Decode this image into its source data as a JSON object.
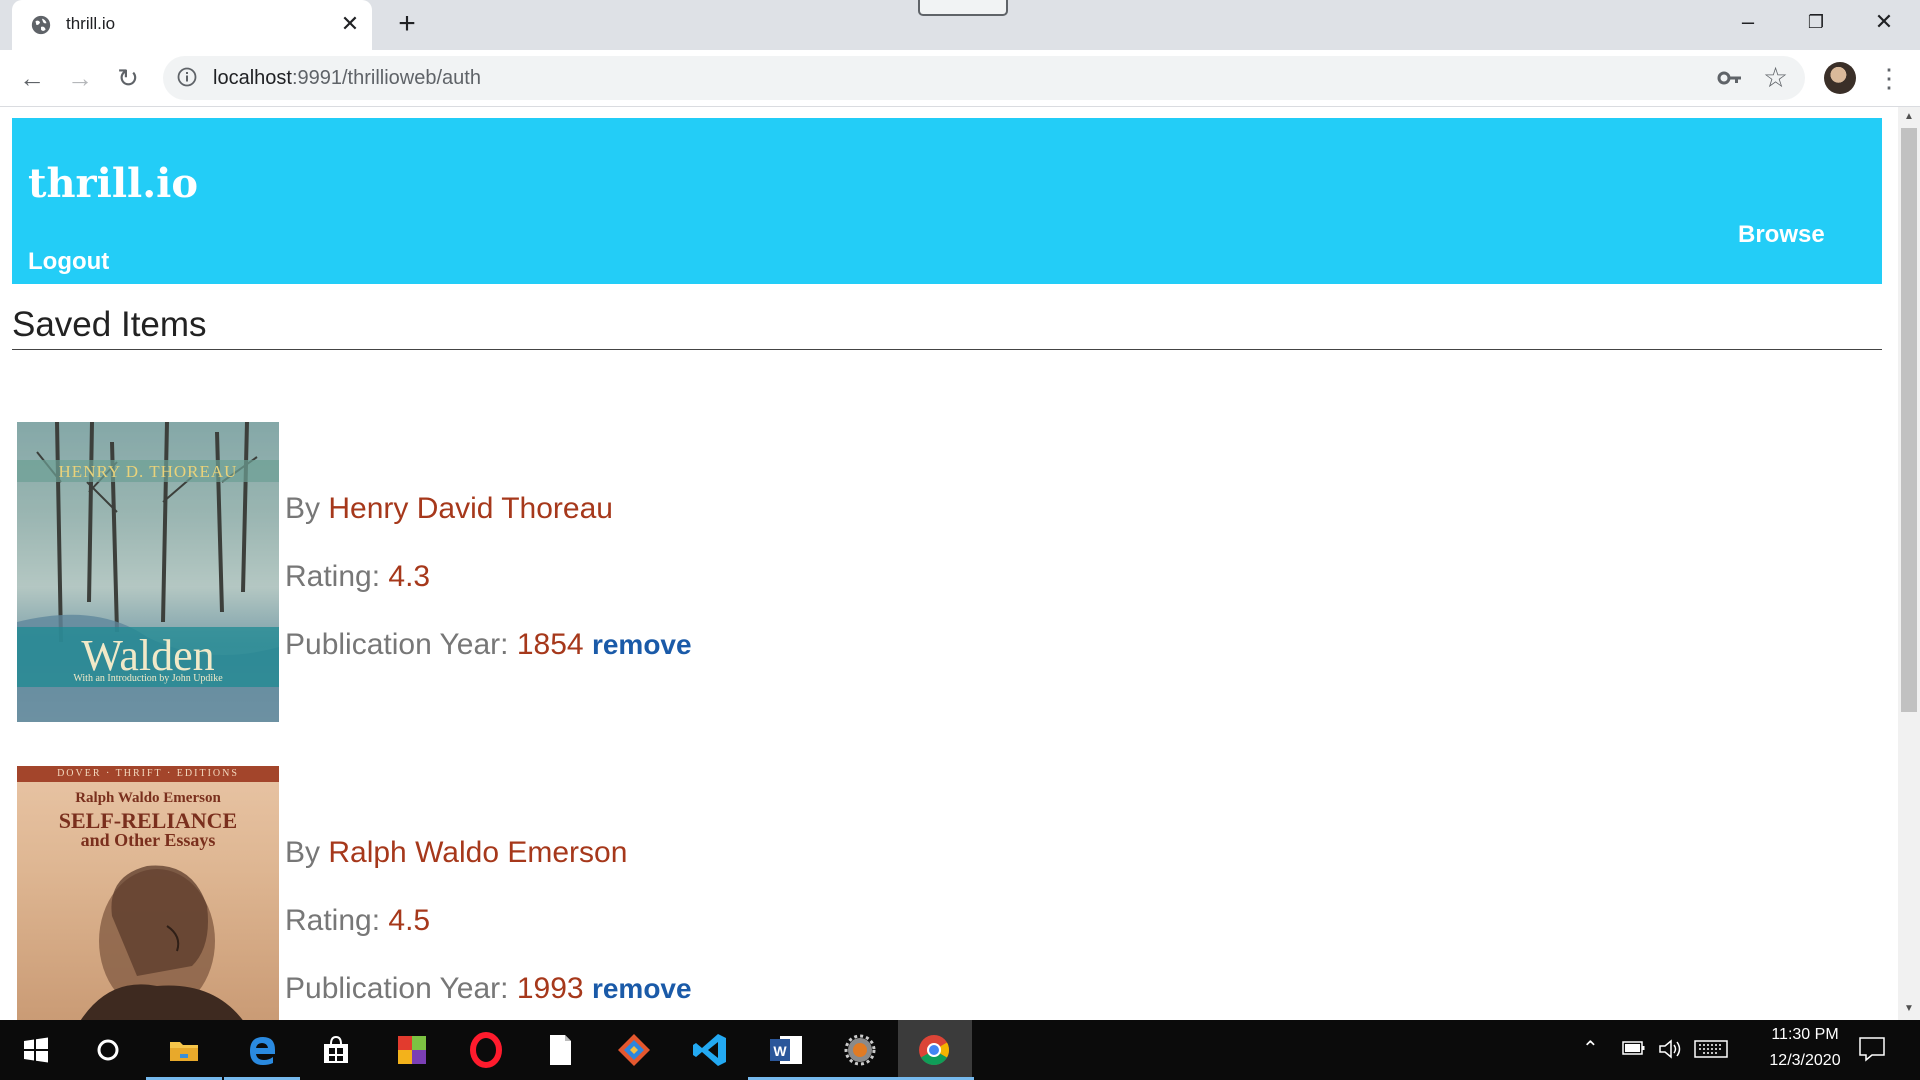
{
  "browser": {
    "tab_title": "thrill.io",
    "url_host": "localhost",
    "url_path": ":9991/thrillioweb/auth"
  },
  "site": {
    "logo": "thrill.io",
    "logout": "Logout",
    "browse": "Browse",
    "section_title": "Saved Items"
  },
  "items": [
    {
      "cover_author": "HENRY D. THOREAU",
      "cover_title": "Walden",
      "cover_sub": "With an Introduction by John Updike",
      "by_label": "By",
      "author": "Henry David Thoreau",
      "rating_label": "Rating:",
      "rating": "4.3",
      "year_label": "Publication Year:",
      "year": "1854",
      "remove": "remove"
    },
    {
      "cover_series": "DOVER · THRIFT · EDITIONS",
      "cover_author": "Ralph Waldo Emerson",
      "cover_title": "SELF-RELIANCE",
      "cover_sub": "and Other Essays",
      "by_label": "By",
      "author": "Ralph Waldo Emerson",
      "rating_label": "Rating:",
      "rating": "4.5",
      "year_label": "Publication Year:",
      "year": "1993",
      "remove": "remove"
    }
  ],
  "taskbar": {
    "time": "11:30 PM",
    "date": "12/3/2020"
  }
}
